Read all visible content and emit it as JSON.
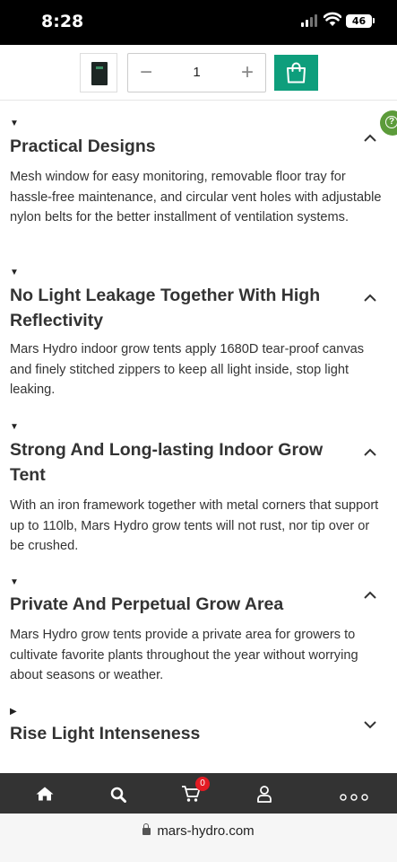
{
  "status_bar": {
    "time": "8:28",
    "battery": "46",
    "icons": [
      "signal-icon",
      "wifi-icon",
      "battery-icon"
    ]
  },
  "product_bar": {
    "quantity": "1",
    "minus_label": "−",
    "plus_label": "+",
    "icons": [
      "product-thumbnail",
      "shopping-bag-icon"
    ],
    "accent_color": "#0e9e7c"
  },
  "help": {
    "label": "?",
    "color": "#5c9b3a"
  },
  "sections": [
    {
      "title": "Practical Designs",
      "expanded": true,
      "description": "Mesh window for easy monitoring, removable floor tray for hassle-free maintenance, and circular vent holes with adjustable nylon belts for the better installment of ventilation systems."
    },
    {
      "title": "No Light Leakage Together With High Reflectivity",
      "expanded": true,
      "description": "Mars Hydro indoor grow tents apply 1680D tear-proof canvas and finely stitched zippers to keep all light inside, stop light leaking."
    },
    {
      "title": "Strong And Long-lasting Indoor Grow Tent",
      "expanded": true,
      "description": "With an iron framework together with metal corners that support up to 110lb, Mars Hydro grow tents will not rust, nor tip over or be crushed."
    },
    {
      "title": "Private And Perpetual Grow Area",
      "expanded": true,
      "description": "Mars Hydro grow tents provide a private area for growers to cultivate favorite plants throughout the year without worrying about seasons or weather."
    },
    {
      "title": "Rise Light Intenseness",
      "expanded": false,
      "description": ""
    }
  ],
  "markers": {
    "expanded": "▼",
    "collapsed": "▶"
  },
  "bottom_nav": {
    "items": [
      "home-icon",
      "search-icon",
      "cart-icon",
      "account-icon",
      "more-icon"
    ],
    "cart_count": "0",
    "background": "#333333",
    "badge_color": "#e31b23"
  },
  "url_bar": {
    "domain": "mars-hydro.com"
  }
}
